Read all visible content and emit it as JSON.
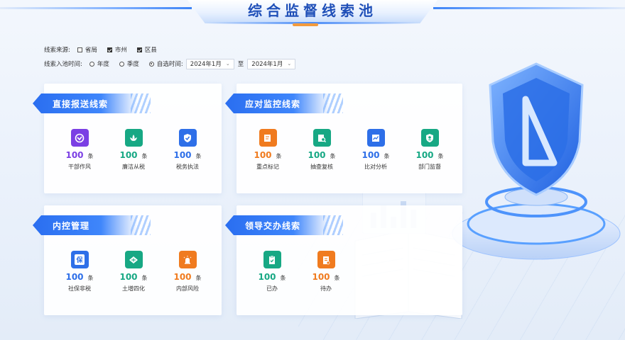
{
  "header": {
    "title": "综合监督线索池"
  },
  "filters": {
    "source_label": "线索来源:",
    "sources": [
      {
        "label": "省局",
        "checked": false
      },
      {
        "label": "市州",
        "checked": true
      },
      {
        "label": "区县",
        "checked": true
      }
    ],
    "time_label": "线索入池时间:",
    "time_options": [
      {
        "label": "年度",
        "selected": false
      },
      {
        "label": "季度",
        "selected": false
      },
      {
        "label": "自选时间:",
        "selected": true
      }
    ],
    "date_from": "2024年1月",
    "to_label": "至",
    "date_to": "2024年1月"
  },
  "cards": {
    "direct": {
      "title": "直接报送线索",
      "items": [
        {
          "count": "100",
          "unit": "条",
          "name": "干部作风",
          "color": "#7b3fe4",
          "icon": "cadre-style-icon"
        },
        {
          "count": "100",
          "unit": "条",
          "name": "廉洁从税",
          "color": "#17a884",
          "icon": "lotus-icon"
        },
        {
          "count": "100",
          "unit": "条",
          "name": "税务执法",
          "color": "#2e6fe8",
          "icon": "shield-check-icon"
        }
      ]
    },
    "monitor": {
      "title": "应对监控线索",
      "items": [
        {
          "count": "100",
          "unit": "条",
          "name": "重点标记",
          "color": "#f07b1f",
          "icon": "edit-document-icon"
        },
        {
          "count": "100",
          "unit": "条",
          "name": "抽查复核",
          "color": "#17a884",
          "icon": "search-review-icon"
        },
        {
          "count": "100",
          "unit": "条",
          "name": "比对分析",
          "color": "#2e6fe8",
          "icon": "analysis-chart-icon"
        },
        {
          "count": "100",
          "unit": "条",
          "name": "部门监督",
          "color": "#17a884",
          "icon": "department-user-icon"
        }
      ]
    },
    "internal": {
      "title": "内控管理",
      "items": [
        {
          "count": "100",
          "unit": "条",
          "name": "社保非税",
          "color": "#2e6fe8",
          "icon": "social-security-icon",
          "glyph": "保"
        },
        {
          "count": "100",
          "unit": "条",
          "name": "土增四化",
          "color": "#17a884",
          "icon": "land-grid-icon"
        },
        {
          "count": "100",
          "unit": "条",
          "name": "内部风险",
          "color": "#f07b1f",
          "icon": "alarm-light-icon"
        }
      ]
    },
    "leader": {
      "title": "领导交办线索",
      "items": [
        {
          "count": "100",
          "unit": "条",
          "name": "已办",
          "color": "#17a884",
          "icon": "clipboard-check-icon"
        },
        {
          "count": "100",
          "unit": "条",
          "name": "待办",
          "color": "#f07b1f",
          "icon": "clipboard-pending-icon"
        }
      ]
    }
  }
}
